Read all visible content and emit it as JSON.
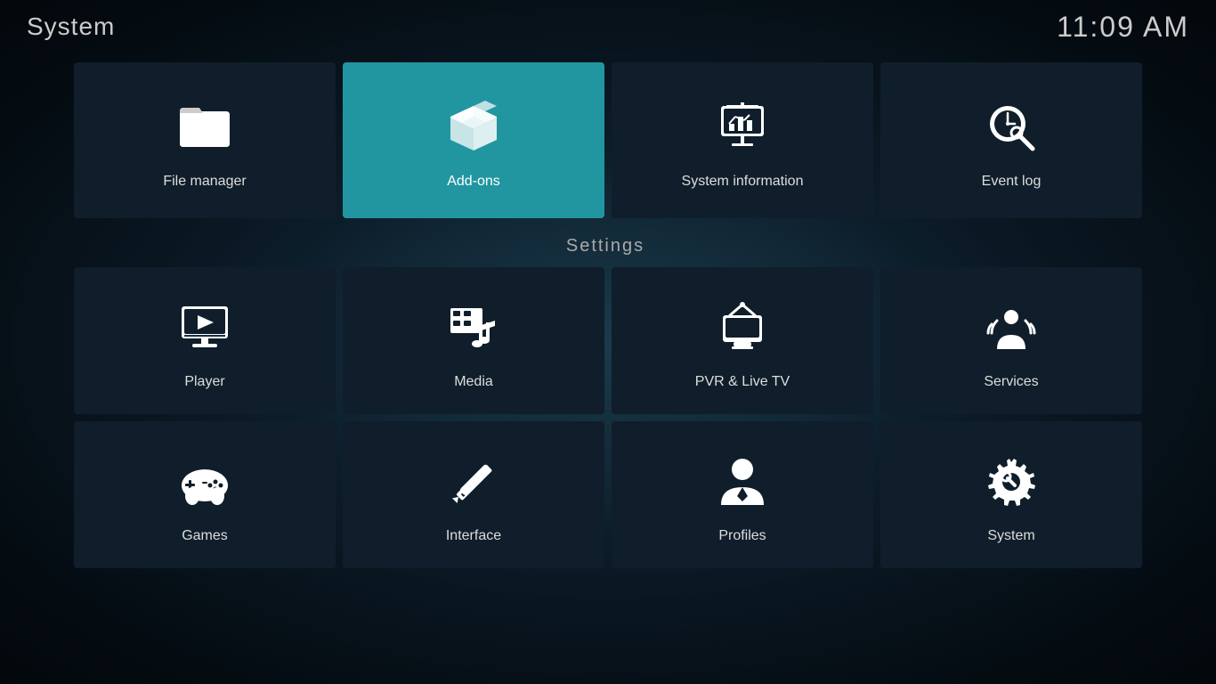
{
  "header": {
    "title": "System",
    "time": "11:09 AM"
  },
  "top_row": [
    {
      "id": "file-manager",
      "label": "File manager",
      "active": false
    },
    {
      "id": "add-ons",
      "label": "Add-ons",
      "active": true
    },
    {
      "id": "system-information",
      "label": "System information",
      "active": false
    },
    {
      "id": "event-log",
      "label": "Event log",
      "active": false
    }
  ],
  "settings_label": "Settings",
  "settings_row1": [
    {
      "id": "player",
      "label": "Player"
    },
    {
      "id": "media",
      "label": "Media"
    },
    {
      "id": "pvr-live-tv",
      "label": "PVR & Live TV"
    },
    {
      "id": "services",
      "label": "Services"
    }
  ],
  "settings_row2": [
    {
      "id": "games",
      "label": "Games"
    },
    {
      "id": "interface",
      "label": "Interface"
    },
    {
      "id": "profiles",
      "label": "Profiles"
    },
    {
      "id": "system-settings",
      "label": "System"
    }
  ]
}
